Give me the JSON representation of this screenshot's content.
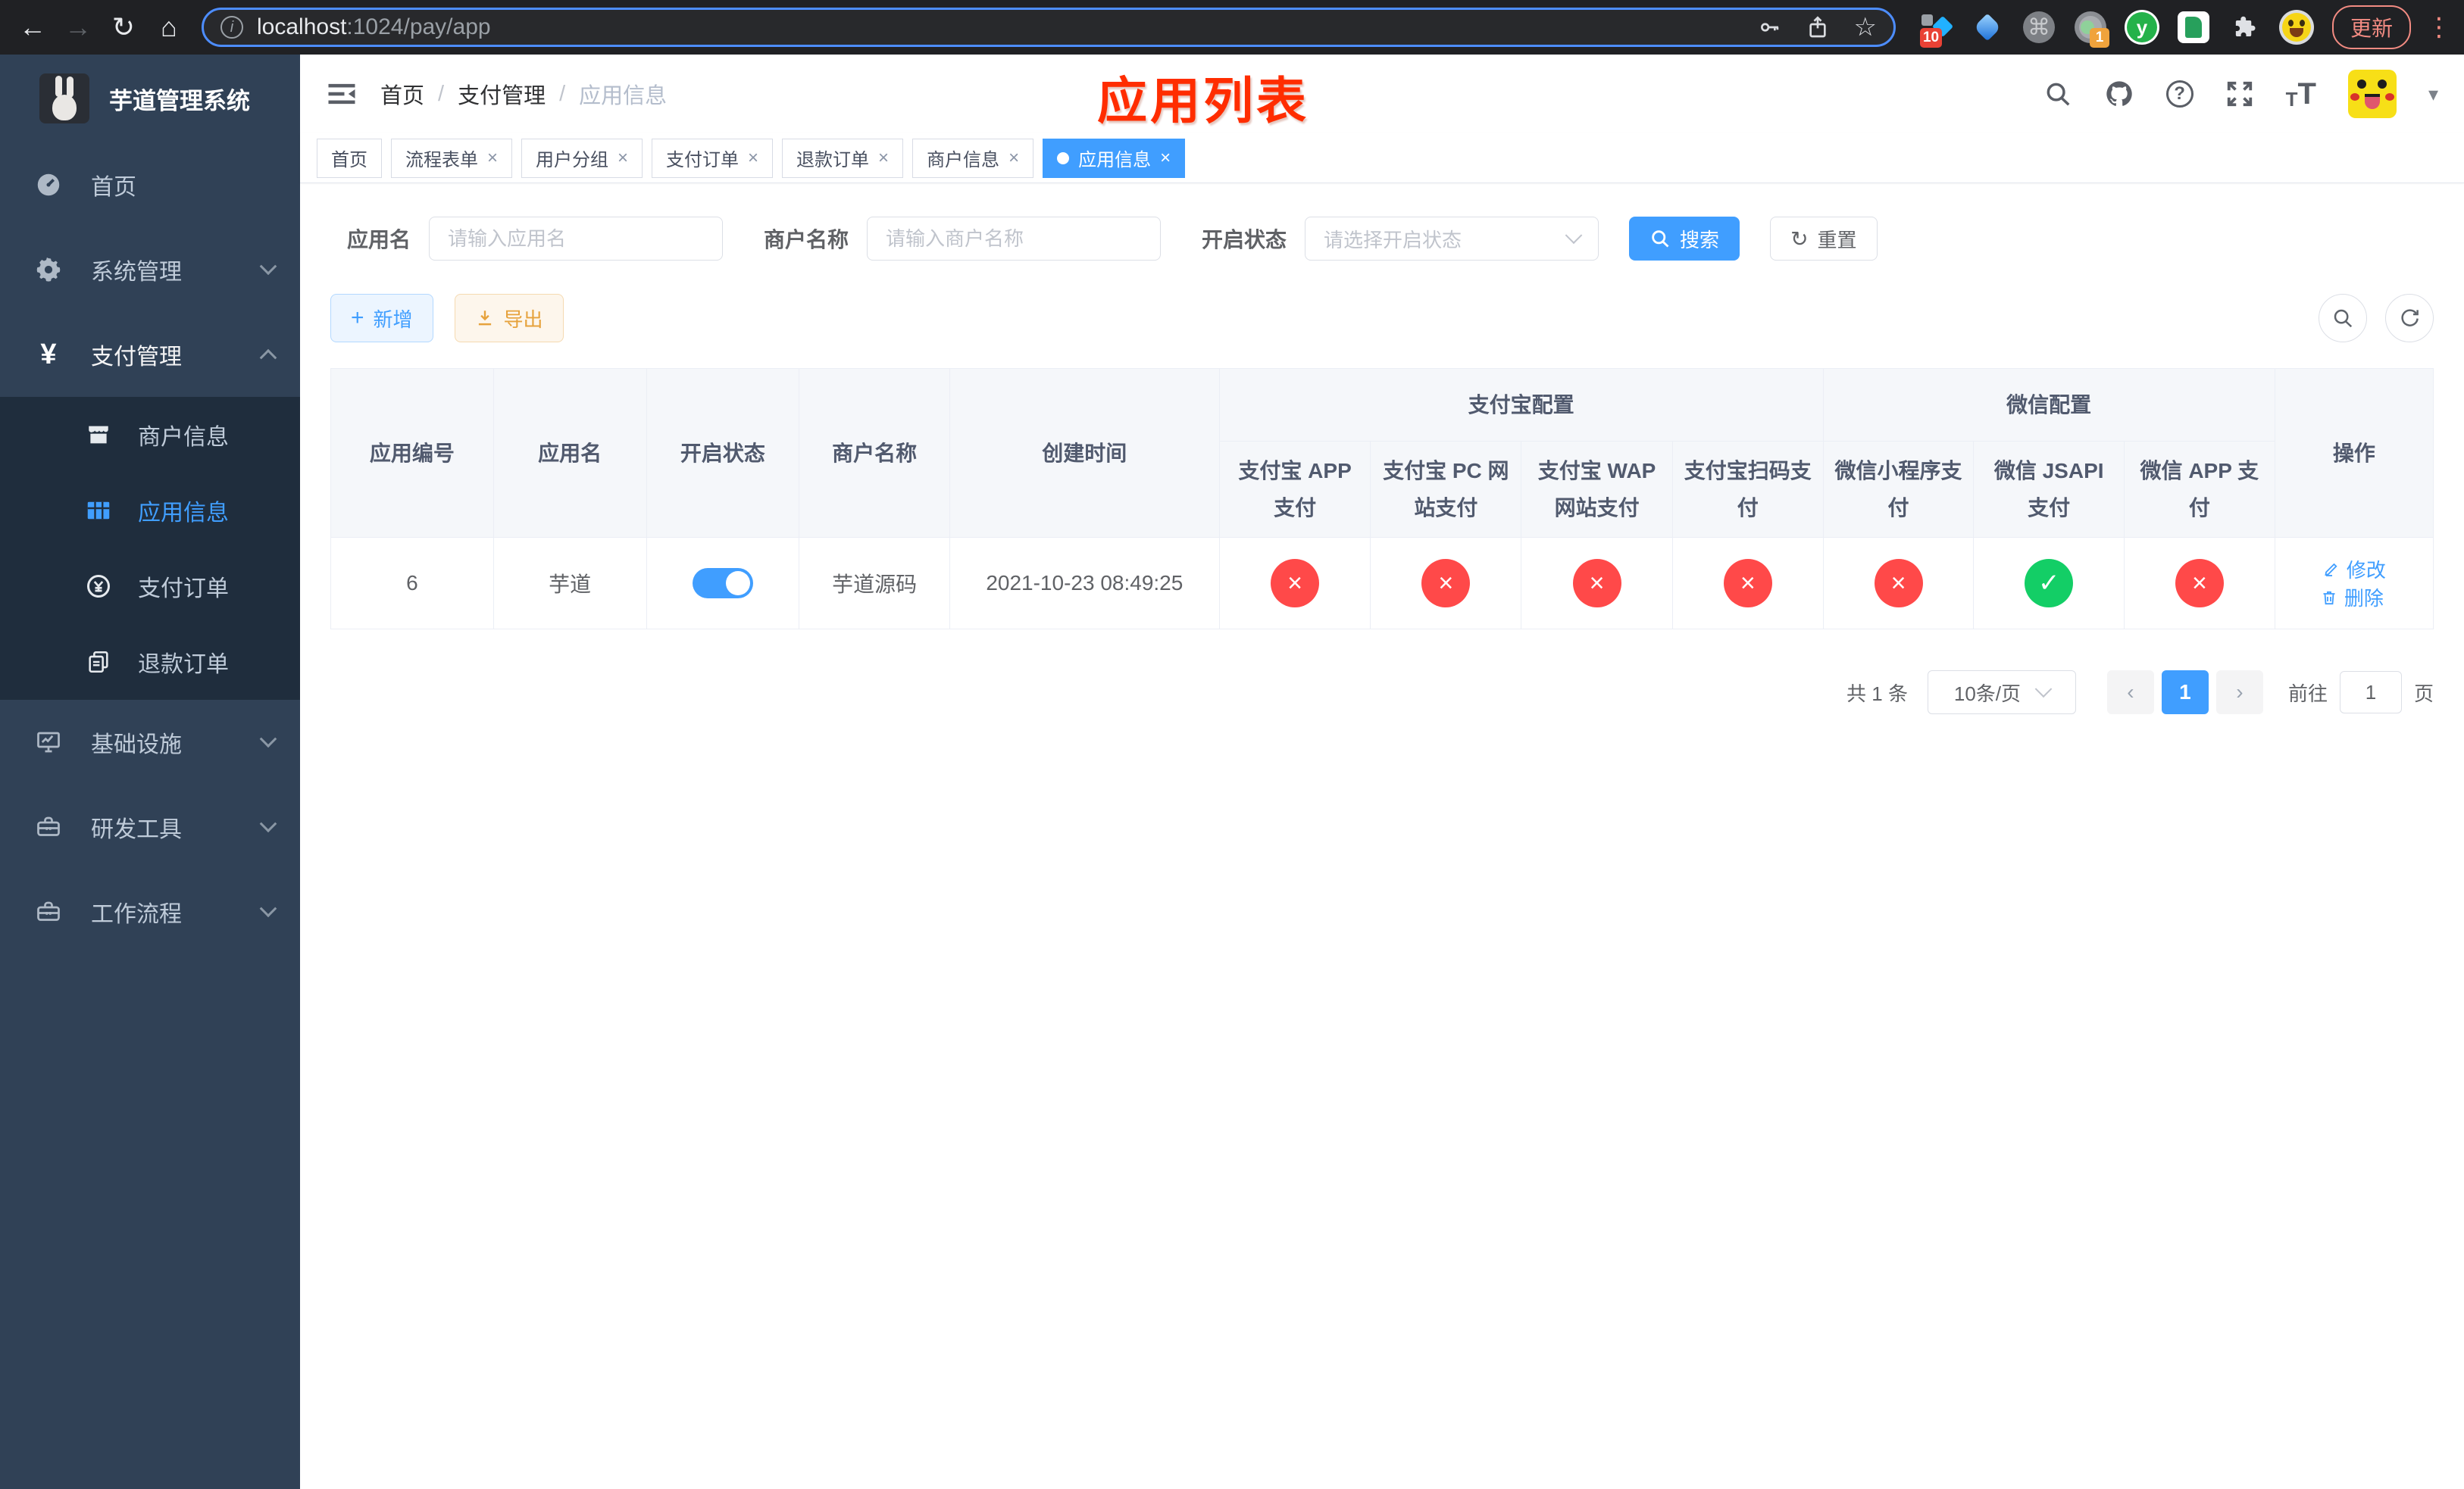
{
  "browser": {
    "url_host": "localhost",
    "url_path": ":1024/pay/app",
    "update_label": "更新",
    "ext_badges": {
      "blocker": "10",
      "session": "1"
    },
    "ext_y_letter": "y"
  },
  "icons": {
    "back": "←",
    "forward": "→",
    "reload": "↻",
    "home": "⌂",
    "star": "☆",
    "command": "⌘",
    "kebab": "⋮",
    "caret_down": "▾",
    "question": "?",
    "info": "i",
    "prev": "‹",
    "next": "›",
    "close": "×",
    "check": "✓",
    "plus": "+",
    "refresh": "↻",
    "yen": "¥"
  },
  "sidebar": {
    "title": "芋道管理系统",
    "menu": [
      {
        "label": "首页"
      },
      {
        "label": "系统管理"
      },
      {
        "label": "支付管理"
      },
      {
        "label": "基础设施"
      },
      {
        "label": "研发工具"
      },
      {
        "label": "工作流程"
      }
    ],
    "pay_submenu": [
      {
        "label": "商户信息"
      },
      {
        "label": "应用信息"
      },
      {
        "label": "支付订单"
      },
      {
        "label": "退款订单"
      }
    ]
  },
  "header": {
    "breadcrumb": [
      "首页",
      "支付管理",
      "应用信息"
    ],
    "separator": "/"
  },
  "annotation": {
    "text": "应用列表",
    "color": "#ff2d00"
  },
  "tabs": [
    {
      "label": "首页"
    },
    {
      "label": "流程表单"
    },
    {
      "label": "用户分组"
    },
    {
      "label": "支付订单"
    },
    {
      "label": "退款订单"
    },
    {
      "label": "商户信息"
    },
    {
      "label": "应用信息"
    }
  ],
  "filters": {
    "app_name_label": "应用名",
    "app_name_placeholder": "请输入应用名",
    "merchant_label": "商户名称",
    "merchant_placeholder": "请输入商户名称",
    "status_label": "开启状态",
    "status_placeholder": "请选择开启状态",
    "search": "搜索",
    "reset": "重置"
  },
  "toolbar": {
    "add": "新增",
    "export": "导出"
  },
  "table": {
    "headers": {
      "id": "应用编号",
      "name": "应用名",
      "status": "开启状态",
      "merchant": "商户名称",
      "created": "创建时间",
      "alipay_group": "支付宝配置",
      "wechat_group": "微信配置",
      "alipay_app": "支付宝 APP 支付",
      "alipay_pc": "支付宝 PC 网站支付",
      "alipay_wap": "支付宝 WAP 网站支付",
      "alipay_qr": "支付宝扫码支付",
      "wx_lite": "微信小程序支付",
      "wx_jsapi": "微信 JSAPI 支付",
      "wx_app": "微信 APP 支付",
      "actions": "操作"
    },
    "row": {
      "id": "6",
      "name": "芋道",
      "enabled": true,
      "merchant": "芋道源码",
      "created": "2021-10-23 08:49:25",
      "channels": {
        "alipay_app": "disabled",
        "alipay_pc": "disabled",
        "alipay_wap": "disabled",
        "alipay_qr": "disabled",
        "wx_lite": "disabled",
        "wx_jsapi": "enabled",
        "wx_app": "disabled"
      },
      "edit": "修改",
      "delete": "删除"
    }
  },
  "pagination": {
    "total": "共 1 条",
    "page_size": "10条/页",
    "page": "1",
    "goto_label": "前往",
    "goto_value": "1",
    "goto_unit": "页"
  },
  "colors": {
    "accent": "#409eff",
    "danger": "#ff4949",
    "success": "#13ce66"
  }
}
